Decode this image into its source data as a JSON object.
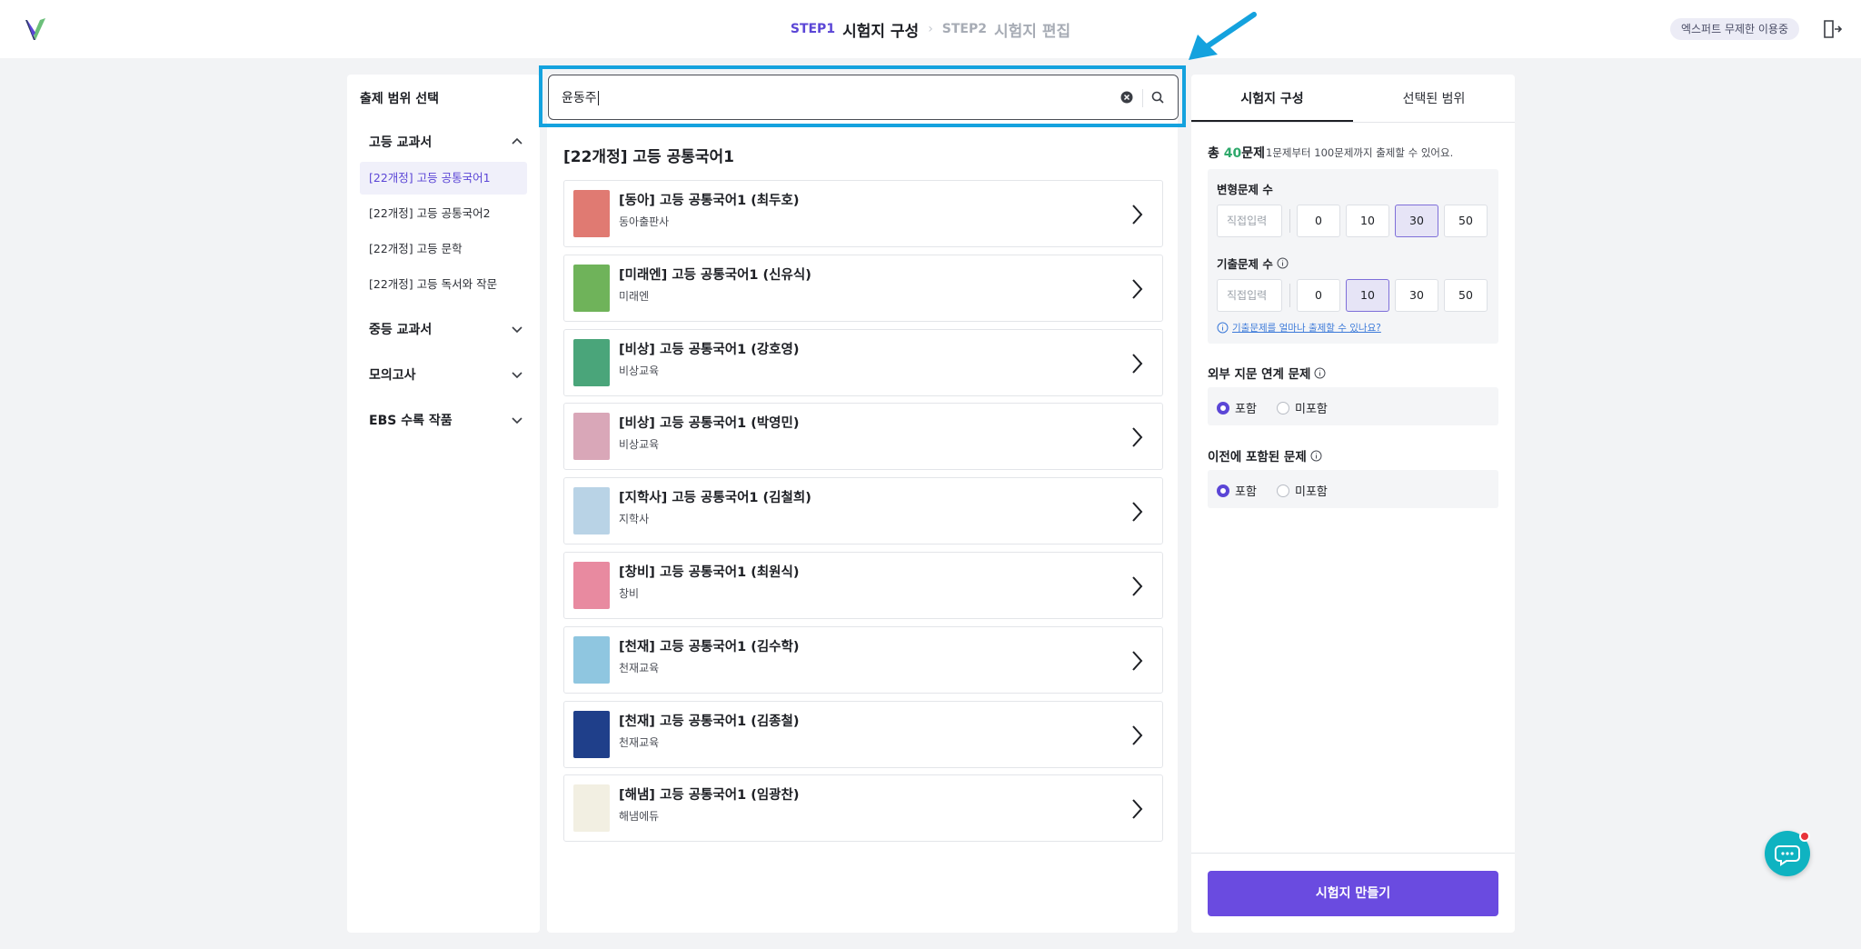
{
  "header": {
    "step1_num": "STEP1",
    "step1_name": "시험지 구성",
    "step2_num": "STEP2",
    "step2_name": "시험지 편집",
    "separator": "›",
    "user_badge": "엑스퍼트 무제한 이용중"
  },
  "sidebar": {
    "title": "출제 범위 선택",
    "sections": [
      {
        "label": "고등 교과서",
        "expanded": true
      },
      {
        "label": "중등 교과서",
        "expanded": false
      },
      {
        "label": "모의고사",
        "expanded": false
      },
      {
        "label": "EBS 수록 작품",
        "expanded": false
      }
    ],
    "sub_items": [
      {
        "label": "[22개정] 고등 공통국어1",
        "active": true
      },
      {
        "label": "[22개정] 고등 공통국어2",
        "active": false
      },
      {
        "label": "[22개정] 고등 문학",
        "active": false
      },
      {
        "label": "[22개정] 고등 독서와 작문",
        "active": false
      }
    ]
  },
  "search": {
    "value": "윤동주"
  },
  "list": {
    "title": "[22개정] 고등 공통국어1",
    "books": [
      {
        "title": "[동아] 고등 공통국어1 (최두호)",
        "publisher": "동아출판사",
        "color": "#e07a72"
      },
      {
        "title": "[미래엔] 고등 공통국어1 (신유식)",
        "publisher": "미래엔",
        "color": "#6fb35a"
      },
      {
        "title": "[비상] 고등 공통국어1 (강호영)",
        "publisher": "비상교육",
        "color": "#4aa57a"
      },
      {
        "title": "[비상] 고등 공통국어1 (박영민)",
        "publisher": "비상교육",
        "color": "#d9a7b8"
      },
      {
        "title": "[지학사] 고등 공통국어1 (김철희)",
        "publisher": "지학사",
        "color": "#b9d3e6"
      },
      {
        "title": "[창비] 고등 공통국어1 (최원식)",
        "publisher": "창비",
        "color": "#e88aa0"
      },
      {
        "title": "[천재] 고등 공통국어1 (김수학)",
        "publisher": "천재교육",
        "color": "#8fc6e0"
      },
      {
        "title": "[천재] 고등 공통국어1 (김종철)",
        "publisher": "천재교육",
        "color": "#1f3f8a"
      },
      {
        "title": "[해냄] 고등 공통국어1 (임광찬)",
        "publisher": "해냄에듀",
        "color": "#f2efe2"
      }
    ]
  },
  "right": {
    "tab_active": "시험지 구성",
    "tab_inactive": "선택된 범위",
    "total_prefix": "총 ",
    "total_num": "40",
    "total_suffix": "문제",
    "total_note": "1문제부터 100문제까지 출제할 수 있어요.",
    "variant_label": "변형문제 수",
    "past_label": "기출문제 수",
    "input_placeholder": "직접입력",
    "options": [
      "0",
      "10",
      "30",
      "50"
    ],
    "variant_selected": "30",
    "past_selected": "10",
    "hint": "기출문제를 얼마나 출제할 수 있나요?",
    "external_label": "외부 지문 연계 문제",
    "previous_label": "이전에 포함된 문제",
    "include": "포함",
    "exclude": "미포함",
    "make_button": "시험지 만들기"
  },
  "colors": {
    "accent": "#5b46d6",
    "button": "#6a4be0",
    "highlight": "#14a2de",
    "count": "#2ea86b"
  },
  "icons": [
    "logo-icon",
    "logout-icon",
    "chevron-up-icon",
    "chevron-down-icon",
    "clear-icon",
    "search-icon",
    "chevron-right-icon",
    "info-icon",
    "chat-icon",
    "arrow-annotation"
  ]
}
